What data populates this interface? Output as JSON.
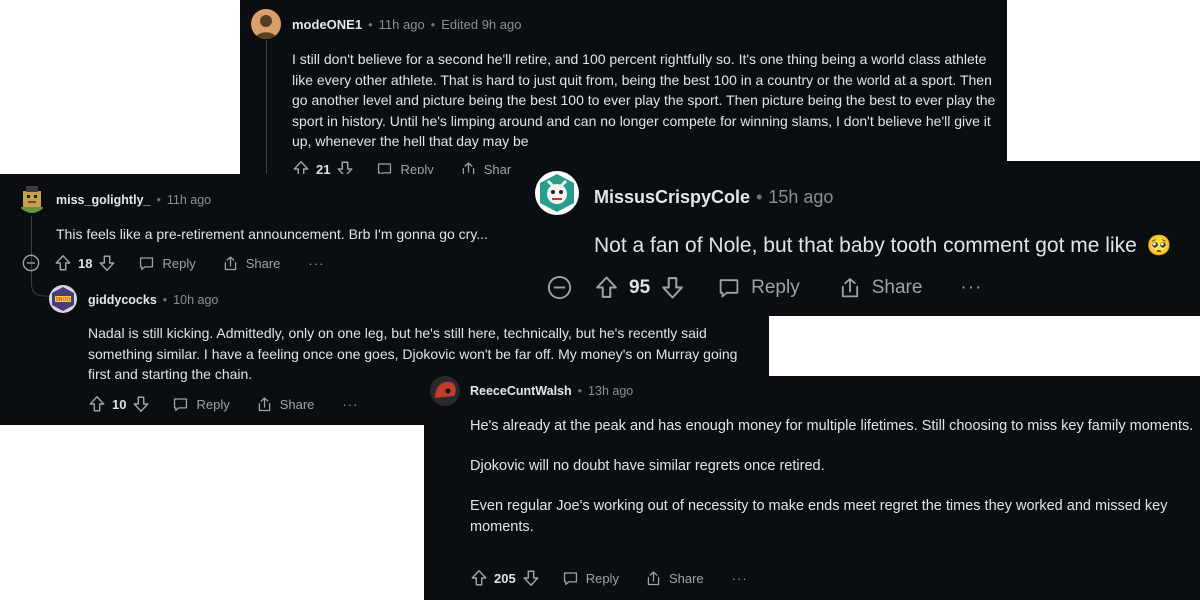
{
  "comments": {
    "mode": {
      "user": "modeONE1",
      "time": "11h ago",
      "edited": "Edited 9h ago",
      "text": "I still don't believe for a second he'll retire, and 100 percent rightfully so. It's one thing being a world class athlete like every other athlete. That is hard to just quit from, being the best 100 in a country or the world at a sport. Then go another level and picture being the best 100 to ever play the sport. Then picture being the best to ever play the sport in history. Until he's limping around and can no longer compete for winning slams, I don't believe he'll give it up, whenever the hell that day may be",
      "votes": "21",
      "reply": "Reply",
      "share": "Share"
    },
    "miss": {
      "user": "miss_golightly_",
      "time": "11h ago",
      "text": "This feels like a pre-retirement announcement. Brb I'm gonna go cry...",
      "votes": "18",
      "reply": "Reply",
      "share": "Share",
      "more": "···"
    },
    "giddy": {
      "user": "giddycocks",
      "time": "10h ago",
      "text": "Nadal is still kicking. Admittedly, only on one leg, but he's still here, technically, but he's recently said something similar. I have a feeling once one goes, Djokovic won't be far off. My money's on Murray going first and starting the chain.",
      "votes": "10",
      "reply": "Reply",
      "share": "Share",
      "more": "···"
    },
    "missus": {
      "user": "MissusCrispyCole",
      "time": "15h ago",
      "text": "Not a fan of Nole, but that baby tooth comment got me like",
      "emoji": "🥺",
      "votes": "95",
      "reply": "Reply",
      "share": "Share",
      "more": "···"
    },
    "reece": {
      "user": "ReeceCuntWalsh",
      "time": "13h ago",
      "paragraphs": [
        "He's already at the peak and has enough money for multiple lifetimes. Still choosing to miss key family moments.",
        "Djokovic will no doubt have similar regrets once retired.",
        "Even regular Joe's working out of necessity to make ends meet regret the times they worked and missed key moments."
      ],
      "votes": "205",
      "reply": "Reply",
      "share": "Share",
      "more": "···"
    }
  },
  "colors": {
    "background": "#0b0e10",
    "text": "#e2e4e6",
    "muted": "#8a8f93",
    "page": "#ffffff"
  }
}
